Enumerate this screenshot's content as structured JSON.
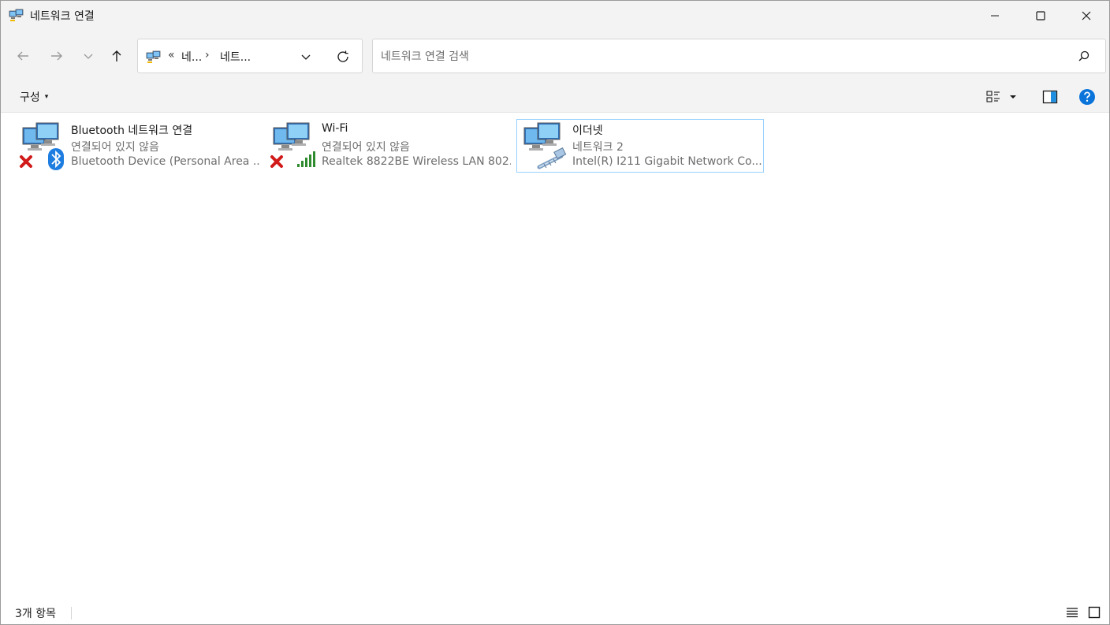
{
  "window": {
    "title": "네트워크 연결",
    "icon": "network-connections-icon"
  },
  "nav": {
    "back_icon": "arrow-left-icon",
    "forward_icon": "arrow-right-icon",
    "recent_icon": "chevron-down-icon",
    "up_icon": "arrow-up-icon"
  },
  "address": {
    "overflow": "«",
    "segments": [
      "네...",
      "네트..."
    ],
    "separator": "›"
  },
  "search": {
    "placeholder": "네트워크 연결 검색",
    "value": ""
  },
  "commandbar": {
    "organize_label": "구성",
    "caret": "▾"
  },
  "connections": [
    {
      "name": "Bluetooth 네트워크 연결",
      "status": "연결되어 있지 않음",
      "device": "Bluetooth Device (Personal Area ...",
      "badge": "bluetooth-icon",
      "disconnected": true,
      "selected": false
    },
    {
      "name": "Wi-Fi",
      "status": "연결되어 있지 않음",
      "device": "Realtek 8822BE Wireless LAN 802...",
      "badge": "signal-bars-icon",
      "disconnected": true,
      "selected": false
    },
    {
      "name": "이더넷",
      "status": "네트워크 2",
      "device": "Intel(R) I211 Gigabit Network Co...",
      "badge": "ethernet-cable-icon",
      "disconnected": false,
      "selected": true
    }
  ],
  "statusbar": {
    "item_count": "3개 항목"
  },
  "colors": {
    "chrome": "#f3f3f3",
    "selection_border": "#99d1ff",
    "help_blue": "#0a74da",
    "error_red": "#d11a1a",
    "signal_green": "#2e8b2e"
  }
}
